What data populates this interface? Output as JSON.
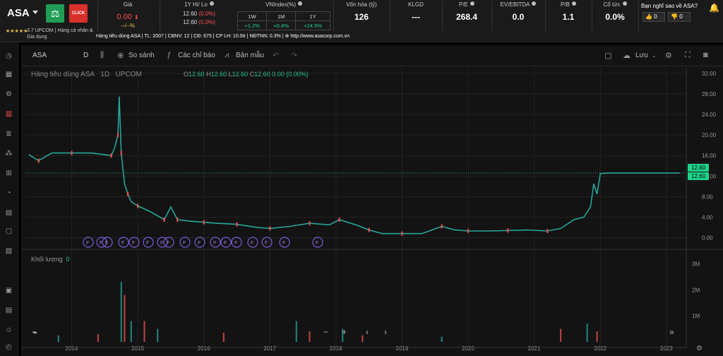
{
  "header": {
    "ticker": "ASA",
    "logo_click_text": "CLICK",
    "rating_stars": "★★★★★",
    "rating_text": "3.7 UPCOM | Hàng cá nhân & Gia dụng",
    "price": {
      "title": "Giá",
      "value": "0.00",
      "change": "--/--%"
    },
    "hilo": {
      "title": "1Y Hi/ Lo",
      "hi": "12.60",
      "hi_pct": "(0.0%)",
      "lo": "12.60",
      "lo_pct": "(0.0%)"
    },
    "vnindex": {
      "title": "VNIndex(%)",
      "cols": [
        "1W",
        "1M",
        "1Y"
      ],
      "vals": [
        "+1.2%",
        "+0.4%",
        "+24.5%"
      ]
    },
    "market_cap": {
      "title": "Vốn hóa (tỷ)",
      "value": "126"
    },
    "klgd": {
      "title": "KLGD",
      "value": "---"
    },
    "pe": {
      "title": "P/E",
      "value": "268.4"
    },
    "ev_ebitda": {
      "title": "EV/EBITDA",
      "value": "0.0"
    },
    "pb": {
      "title": "P/B",
      "value": "1.1"
    },
    "dividend": {
      "title": "Cổ tức",
      "value": "0.0%"
    },
    "poll": {
      "title": "Bạn nghĩ sao về ASA?",
      "up": "0",
      "down": "0"
    },
    "infoline": "Hàng tiêu dùng ASA | TL: 2007 | CBNV: 12 | CĐ: 675 | CP LH: 10.0tr | NĐTNN: 0.3% | ⊕ http://www.asacorp.com.vn"
  },
  "toolbar": {
    "symbol": "ASA",
    "interval": "D",
    "compare": "So sánh",
    "indicators": "Các chỉ báo",
    "templates": "Bản mẫu",
    "save": "Lưu"
  },
  "legend": {
    "title": "Hàng tiêu dùng ASA",
    "interval": "1D",
    "exchange": "UPCOM",
    "o_label": "O",
    "o": "12.60",
    "h_label": "H",
    "h": "12.60",
    "l_label": "L",
    "l": "12.60",
    "c_label": "C",
    "c": "12.60",
    "chg": "0.00 (0.00%)",
    "volume_label": "Khối lượng",
    "volume_value": "0"
  },
  "price_labels": [
    "12.60",
    "12.60"
  ],
  "colors": {
    "up": "#26a69a",
    "down": "#ef5350",
    "accent": "#1fd38a",
    "red": "#ff4d4d",
    "bg": "#131313"
  },
  "chart_data": {
    "type": "line",
    "title": "",
    "xlabel": "",
    "ylabel": "",
    "x_ticks": [
      "2014",
      "2015",
      "2016",
      "2017",
      "2018",
      "2019",
      "2020",
      "2021",
      "2022",
      "2023"
    ],
    "y_ticks": [
      "32.00",
      "28.00",
      "24.00",
      "20.00",
      "16.00",
      "12.00",
      "8.00",
      "4.00",
      "0.00"
    ],
    "ylim": [
      -2,
      32
    ],
    "vol_ticks": [
      "3M",
      "2M",
      "1M"
    ],
    "series": [
      {
        "x": [
          2013.35,
          2013.5,
          2013.7,
          2014.0,
          2014.3,
          2014.6,
          2014.65,
          2014.7,
          2014.72,
          2014.75,
          2014.8,
          2014.85,
          2014.9,
          2015.0,
          2015.2,
          2015.4,
          2015.5,
          2015.6,
          2015.8,
          2016.0,
          2016.2,
          2016.5,
          2016.8,
          2017.0,
          2017.3,
          2017.6,
          2017.9,
          2018.05,
          2018.3,
          2018.5,
          2018.7,
          2019.0,
          2019.3,
          2019.6,
          2019.8,
          2020.0,
          2020.3,
          2020.6,
          2020.9,
          2021.2,
          2021.4,
          2021.6,
          2021.75,
          2021.85,
          2021.9,
          2021.95,
          2022.0,
          2022.1,
          2022.5,
          2023.2
        ],
        "values": [
          16.2,
          15.0,
          16.5,
          16.5,
          16.5,
          16.0,
          17.5,
          20.0,
          27.5,
          16.5,
          10.5,
          8.5,
          7.0,
          6.2,
          5.0,
          3.5,
          6.0,
          3.5,
          3.2,
          3.0,
          2.8,
          2.6,
          2.0,
          1.8,
          2.2,
          2.8,
          2.5,
          3.5,
          2.5,
          1.5,
          0.8,
          0.8,
          0.8,
          2.2,
          1.5,
          1.3,
          1.3,
          1.4,
          1.5,
          1.3,
          1.8,
          3.5,
          4.0,
          6.0,
          10.5,
          8.5,
          12.5,
          12.6,
          12.6,
          12.6
        ]
      }
    ],
    "volume": {
      "x": [
        2013.8,
        2014.4,
        2014.75,
        2014.8,
        2014.9,
        2015.1,
        2015.3,
        2016.3,
        2017.4,
        2017.6,
        2018.1,
        2018.4,
        2019.6,
        2021.4,
        2021.8,
        2021.95
      ],
      "values": [
        0.25,
        0.3,
        2.3,
        1.8,
        0.8,
        0.8,
        0.5,
        0.35,
        0.8,
        0.4,
        0.5,
        0.25,
        0.2,
        0.5,
        0.7,
        0.4
      ]
    },
    "event_markers": [
      "F",
      "F",
      "F",
      "F",
      "F",
      "F",
      "F",
      "F",
      "F",
      "F",
      "F",
      "F",
      "F",
      "F",
      "F",
      "F",
      "F"
    ]
  }
}
